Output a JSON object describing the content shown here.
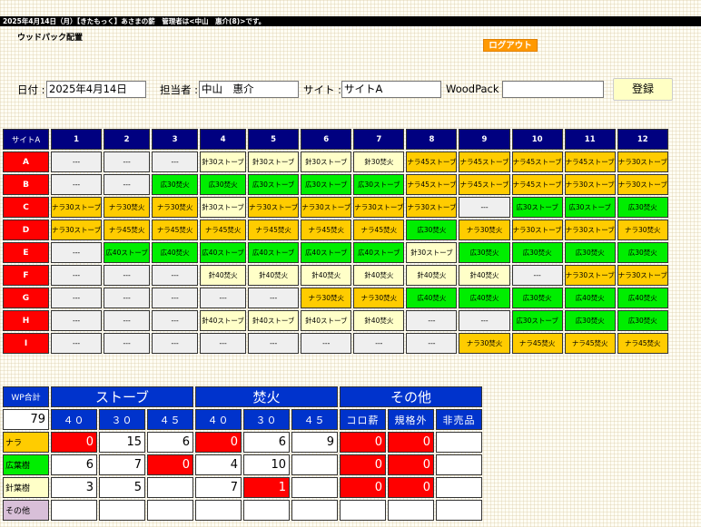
{
  "header": {
    "top_bar": "2025年4月14日（月）【きたもっく】あさまの薪　管理者は<中山　惠介(8)>です。",
    "page_title": "ウッドパック配置",
    "logout_label": "ログアウト"
  },
  "form": {
    "date_label": "日付 :",
    "date_value": "2025年4月14日",
    "staff_label": "担当者 :",
    "staff_value": "中山　惠介",
    "site_label": "サイト :",
    "site_value": "サイトA",
    "woodpack_label": "WoodPack :",
    "woodpack_value": "",
    "register_label": "登録"
  },
  "grid": {
    "corner": "サイトA",
    "columns": [
      "1",
      "2",
      "3",
      "4",
      "5",
      "6",
      "7",
      "8",
      "9",
      "10",
      "11",
      "12"
    ],
    "rows": [
      {
        "label": "A",
        "cells": [
          [
            "---",
            "empty"
          ],
          [
            "---",
            "empty"
          ],
          [
            "---",
            "empty"
          ],
          [
            "針30ストーブ",
            "cream"
          ],
          [
            "針30ストーブ",
            "cream"
          ],
          [
            "針30ストーブ",
            "cream"
          ],
          [
            "針30焚火",
            "cream"
          ],
          [
            "ナラ45ストーブ",
            "yellow"
          ],
          [
            "ナラ45ストーブ",
            "yellow"
          ],
          [
            "ナラ45ストーブ",
            "yellow"
          ],
          [
            "ナラ45ストーブ",
            "yellow"
          ],
          [
            "ナラ30ストーブ",
            "yellow"
          ]
        ]
      },
      {
        "label": "B",
        "cells": [
          [
            "---",
            "empty"
          ],
          [
            "---",
            "empty"
          ],
          [
            "広30焚火",
            "green"
          ],
          [
            "広30焚火",
            "green"
          ],
          [
            "広30ストーブ",
            "green"
          ],
          [
            "広30ストーブ",
            "green"
          ],
          [
            "広30ストーブ",
            "green"
          ],
          [
            "ナラ45ストーブ",
            "yellow"
          ],
          [
            "ナラ45ストーブ",
            "yellow"
          ],
          [
            "ナラ45ストーブ",
            "yellow"
          ],
          [
            "ナラ30ストーブ",
            "yellow"
          ],
          [
            "ナラ30ストーブ",
            "yellow"
          ]
        ]
      },
      {
        "label": "C",
        "cells": [
          [
            "ナラ30ストーブ",
            "yellow"
          ],
          [
            "ナラ30焚火",
            "yellow"
          ],
          [
            "ナラ30焚火",
            "yellow"
          ],
          [
            "針30ストーブ",
            "cream"
          ],
          [
            "ナラ30ストーブ",
            "yellow"
          ],
          [
            "ナラ30ストーブ",
            "yellow"
          ],
          [
            "ナラ30ストーブ",
            "yellow"
          ],
          [
            "ナラ30ストーブ",
            "yellow"
          ],
          [
            "---",
            "empty"
          ],
          [
            "広30ストーブ",
            "green"
          ],
          [
            "広30ストーブ",
            "green"
          ],
          [
            "広30焚火",
            "green"
          ]
        ]
      },
      {
        "label": "D",
        "cells": [
          [
            "ナラ30ストーブ",
            "yellow"
          ],
          [
            "ナラ45焚火",
            "yellow"
          ],
          [
            "ナラ45焚火",
            "yellow"
          ],
          [
            "ナラ45焚火",
            "yellow"
          ],
          [
            "ナラ45焚火",
            "yellow"
          ],
          [
            "ナラ45焚火",
            "yellow"
          ],
          [
            "ナラ45焚火",
            "yellow"
          ],
          [
            "広30焚火",
            "green"
          ],
          [
            "ナラ30焚火",
            "yellow"
          ],
          [
            "ナラ30ストーブ",
            "yellow"
          ],
          [
            "ナラ30ストーブ",
            "yellow"
          ],
          [
            "ナラ30焚火",
            "yellow"
          ]
        ]
      },
      {
        "label": "E",
        "cells": [
          [
            "---",
            "empty"
          ],
          [
            "広40ストーブ",
            "green"
          ],
          [
            "広40焚火",
            "green"
          ],
          [
            "広40ストーブ",
            "green"
          ],
          [
            "広40ストーブ",
            "green"
          ],
          [
            "広40ストーブ",
            "green"
          ],
          [
            "広40ストーブ",
            "green"
          ],
          [
            "針30ストーブ",
            "cream"
          ],
          [
            "広30焚火",
            "green"
          ],
          [
            "広30焚火",
            "green"
          ],
          [
            "広30焚火",
            "green"
          ],
          [
            "広30焚火",
            "green"
          ]
        ]
      },
      {
        "label": "F",
        "cells": [
          [
            "---",
            "empty"
          ],
          [
            "---",
            "empty"
          ],
          [
            "---",
            "empty"
          ],
          [
            "針40焚火",
            "cream"
          ],
          [
            "針40焚火",
            "cream"
          ],
          [
            "針40焚火",
            "cream"
          ],
          [
            "針40焚火",
            "cream"
          ],
          [
            "針40焚火",
            "cream"
          ],
          [
            "針40焚火",
            "cream"
          ],
          [
            "---",
            "empty"
          ],
          [
            "ナラ30ストーブ",
            "yellow"
          ],
          [
            "ナラ30ストーブ",
            "yellow"
          ]
        ]
      },
      {
        "label": "G",
        "cells": [
          [
            "---",
            "empty"
          ],
          [
            "---",
            "empty"
          ],
          [
            "---",
            "empty"
          ],
          [
            "---",
            "empty"
          ],
          [
            "---",
            "empty"
          ],
          [
            "ナラ30焚火",
            "yellow"
          ],
          [
            "ナラ30焚火",
            "yellow"
          ],
          [
            "広40焚火",
            "green"
          ],
          [
            "広40焚火",
            "green"
          ],
          [
            "広30焚火",
            "green"
          ],
          [
            "広40焚火",
            "green"
          ],
          [
            "広40焚火",
            "green"
          ]
        ]
      },
      {
        "label": "H",
        "cells": [
          [
            "---",
            "empty"
          ],
          [
            "---",
            "empty"
          ],
          [
            "---",
            "empty"
          ],
          [
            "針40ストーブ",
            "cream"
          ],
          [
            "針40ストーブ",
            "cream"
          ],
          [
            "針40ストーブ",
            "cream"
          ],
          [
            "針40焚火",
            "cream"
          ],
          [
            "---",
            "empty"
          ],
          [
            "---",
            "empty"
          ],
          [
            "広30ストーブ",
            "green"
          ],
          [
            "広30焚火",
            "green"
          ],
          [
            "広30焚火",
            "green"
          ]
        ]
      },
      {
        "label": "I",
        "cells": [
          [
            "---",
            "empty"
          ],
          [
            "---",
            "empty"
          ],
          [
            "---",
            "empty"
          ],
          [
            "---",
            "empty"
          ],
          [
            "---",
            "empty"
          ],
          [
            "---",
            "empty"
          ],
          [
            "---",
            "empty"
          ],
          [
            "---",
            "empty"
          ],
          [
            "ナラ30焚火",
            "yellow"
          ],
          [
            "ナラ45焚火",
            "yellow"
          ],
          [
            "ナラ45焚火",
            "yellow"
          ],
          [
            "ナラ45焚火",
            "yellow"
          ]
        ]
      }
    ]
  },
  "summary": {
    "total_label": "WP合計",
    "total_value": "79",
    "groups": [
      "ストーブ",
      "焚火",
      "その他"
    ],
    "subheaders": [
      "４０",
      "３０",
      "４５",
      "４０",
      "３０",
      "４５",
      "コロ薪",
      "規格外",
      "非売品"
    ],
    "rows": [
      {
        "label": "ナラ",
        "color": "yellow",
        "values": [
          [
            "0",
            true
          ],
          [
            "15",
            false
          ],
          [
            "6",
            false
          ],
          [
            "0",
            true
          ],
          [
            "6",
            false
          ],
          [
            "9",
            false
          ],
          [
            "0",
            true
          ],
          [
            "0",
            true
          ],
          [
            "",
            false
          ]
        ]
      },
      {
        "label": "広葉樹",
        "color": "green",
        "values": [
          [
            "6",
            false
          ],
          [
            "7",
            false
          ],
          [
            "0",
            true
          ],
          [
            "4",
            false
          ],
          [
            "10",
            false
          ],
          [
            "",
            false
          ],
          [
            "0",
            true
          ],
          [
            "0",
            true
          ],
          [
            "",
            false
          ]
        ]
      },
      {
        "label": "針葉樹",
        "color": "cream",
        "values": [
          [
            "3",
            false
          ],
          [
            "5",
            false
          ],
          [
            "",
            false
          ],
          [
            "7",
            false
          ],
          [
            "1",
            true
          ],
          [
            "",
            false
          ],
          [
            "0",
            true
          ],
          [
            "0",
            true
          ],
          [
            "",
            false
          ]
        ]
      },
      {
        "label": "その他",
        "color": "purple",
        "values": [
          [
            "",
            false
          ],
          [
            "",
            false
          ],
          [
            "",
            false
          ],
          [
            "",
            false
          ],
          [
            "",
            false
          ],
          [
            "",
            false
          ],
          [
            "",
            false
          ],
          [
            "",
            false
          ],
          [
            "",
            false
          ]
        ]
      }
    ]
  }
}
